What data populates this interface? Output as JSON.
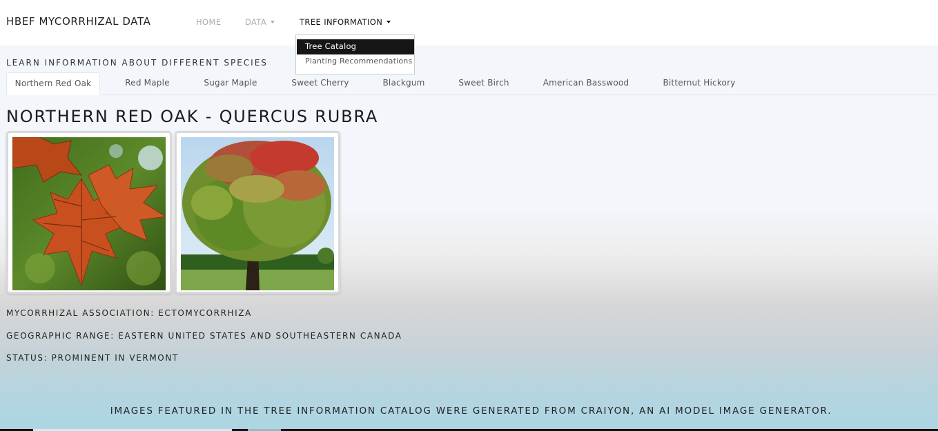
{
  "navbar": {
    "brand": "HBEF MYCORRHIZAL DATA",
    "links": [
      {
        "label": "HOME"
      },
      {
        "label": "DATA"
      },
      {
        "label": "TREE INFORMATION"
      }
    ]
  },
  "dropdown": {
    "items": [
      {
        "label": "Tree Catalog"
      },
      {
        "label": "Planting Recommendations"
      }
    ]
  },
  "main": {
    "heading": "LEARN INFORMATION ABOUT DIFFERENT SPECIES",
    "tabs": [
      {
        "label": "Northern Red Oak"
      },
      {
        "label": "Red Maple"
      },
      {
        "label": "Sugar Maple"
      },
      {
        "label": "Sweet Cherry"
      },
      {
        "label": "Blackgum"
      },
      {
        "label": "Sweet Birch"
      },
      {
        "label": "American Basswood"
      },
      {
        "label": "Bitternut Hickory"
      }
    ],
    "species_title": "NORTHERN RED OAK - QUERCUS RUBRA",
    "info": {
      "association": "MYCORRHIZAL ASSOCIATION: ECTOMYCORRHIZA",
      "range": "GEOGRAPHIC RANGE: EASTERN UNITED STATES AND SOUTHEASTERN CANADA",
      "status": "STATUS: PROMINENT IN VERMONT"
    },
    "footer_note": "IMAGES FEATURED IN THE TREE INFORMATION CATALOG WERE GENERATED FROM CRAIYON, AN AI MODEL IMAGE GENERATOR."
  },
  "colors": {
    "navbar_bg": "#ffffff",
    "dropdown_selected_bg": "#161616",
    "leaf_orange": "#c8501e",
    "foliage_green": "#6f8f2e"
  }
}
